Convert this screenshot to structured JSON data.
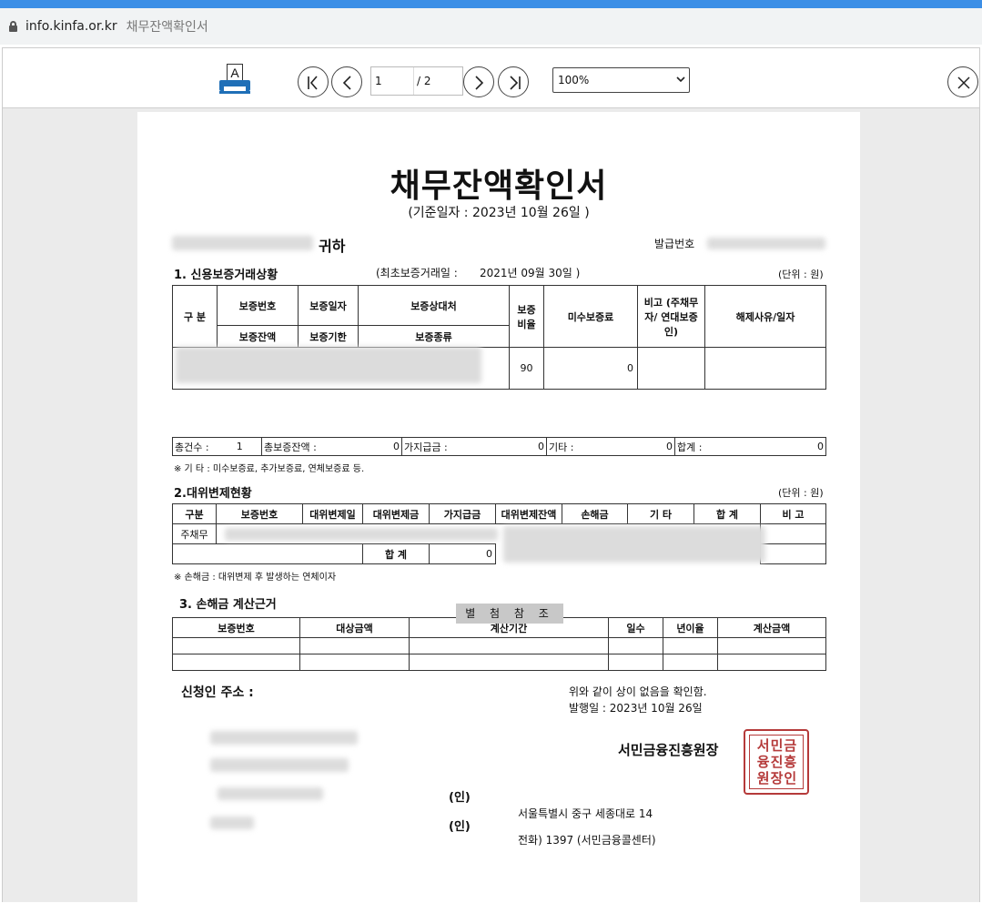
{
  "browser": {
    "host": "info.kinfa.or.kr",
    "title": "채무잔액확인서"
  },
  "viewer": {
    "print_icon_letter": "A",
    "page_current": "1",
    "page_total": "/ 2",
    "zoom": "100%"
  },
  "doc": {
    "title": "채무잔액확인서",
    "base_date": "(기준일자 : 2023년 10월 26일   )",
    "recipient_suffix": "귀하",
    "issue_no_label": "발급번호",
    "sec1": {
      "title": "1. 신용보증거래상황",
      "first_date_label": "(최초보증거래일 :",
      "first_date": "2021년 09월 30일 )",
      "unit": "(단위 : 원)",
      "h_gubun": "구 분",
      "h_no": "보증번호",
      "h_date": "보증일자",
      "h_party": "보증상대처",
      "h_ratio": "보증 비율",
      "h_unpaid": "미수보증료",
      "h_note": "비고 (주채무자/ 연대보증인)",
      "h_release": "해제사유/일자",
      "h_balance": "보증잔액",
      "h_term": "보증기한",
      "h_kind": "보증종류",
      "row_ratio": "90",
      "row_unpaid": "0",
      "sum_count_label": "총건수 :",
      "sum_count": "1",
      "sum_balance_label": "총보증잔액 :",
      "sum_balance": "0",
      "sum_prov_label": "가지급금 :",
      "sum_prov": "0",
      "sum_etc_label": "기타 :",
      "sum_etc": "0",
      "sum_total_label": "합계 :",
      "sum_total": "0",
      "note": "※ 기 타 : 미수보증료, 추가보증료, 연체보증료 등."
    },
    "sec2": {
      "title": "2.대위변제현황",
      "unit": "(단위 : 원)",
      "headers": [
        "구분",
        "보증번호",
        "대위변제일",
        "대위변제금",
        "가지급금",
        "대위변제잔액",
        "손해금",
        "기 타",
        "합 계",
        "비 고"
      ],
      "row_gubun": "주채무",
      "total_label": "합 계",
      "total_prov": "0",
      "note": "※ 손해금 : 대위변제 후 발생하는 연체이자"
    },
    "sec3": {
      "title": "3.  손해금 계산근거",
      "headers": [
        "보증번호",
        "대상금액",
        "계산기간",
        "일수",
        "년이율",
        "계산금액"
      ],
      "attached": "별 첨 참 조"
    },
    "applicant_label": "신청인 주소 :",
    "seal_mark_1": "(인)",
    "seal_mark_2": "(인)",
    "confirm_text": "위와 같이 상이 없음을 확인함.",
    "issue_date": "발행일 : 2023년 10월 26일",
    "issuer": "서민금융진흥원장",
    "seal_text": "서민금융진흥원장인",
    "address": "서울특별시 중구 세종대로 14",
    "phone": "전화)   1397 (서민금융콜센터)"
  }
}
